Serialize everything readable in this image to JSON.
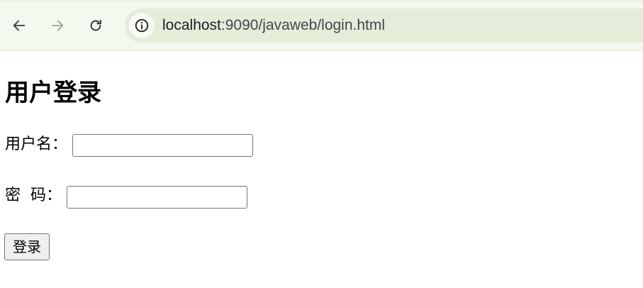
{
  "browser": {
    "url_host": "localhost",
    "url_path": ":9090/javaweb/login.html",
    "icons": {
      "back": "arrow-left-icon",
      "forward": "arrow-right-icon",
      "reload": "reload-icon",
      "site_info": "info-circle-icon"
    }
  },
  "page": {
    "title": "用户登录",
    "username_label": "用户名：",
    "password_label": "密  码：",
    "username_value": "",
    "password_value": "",
    "submit_label": "登录"
  }
}
